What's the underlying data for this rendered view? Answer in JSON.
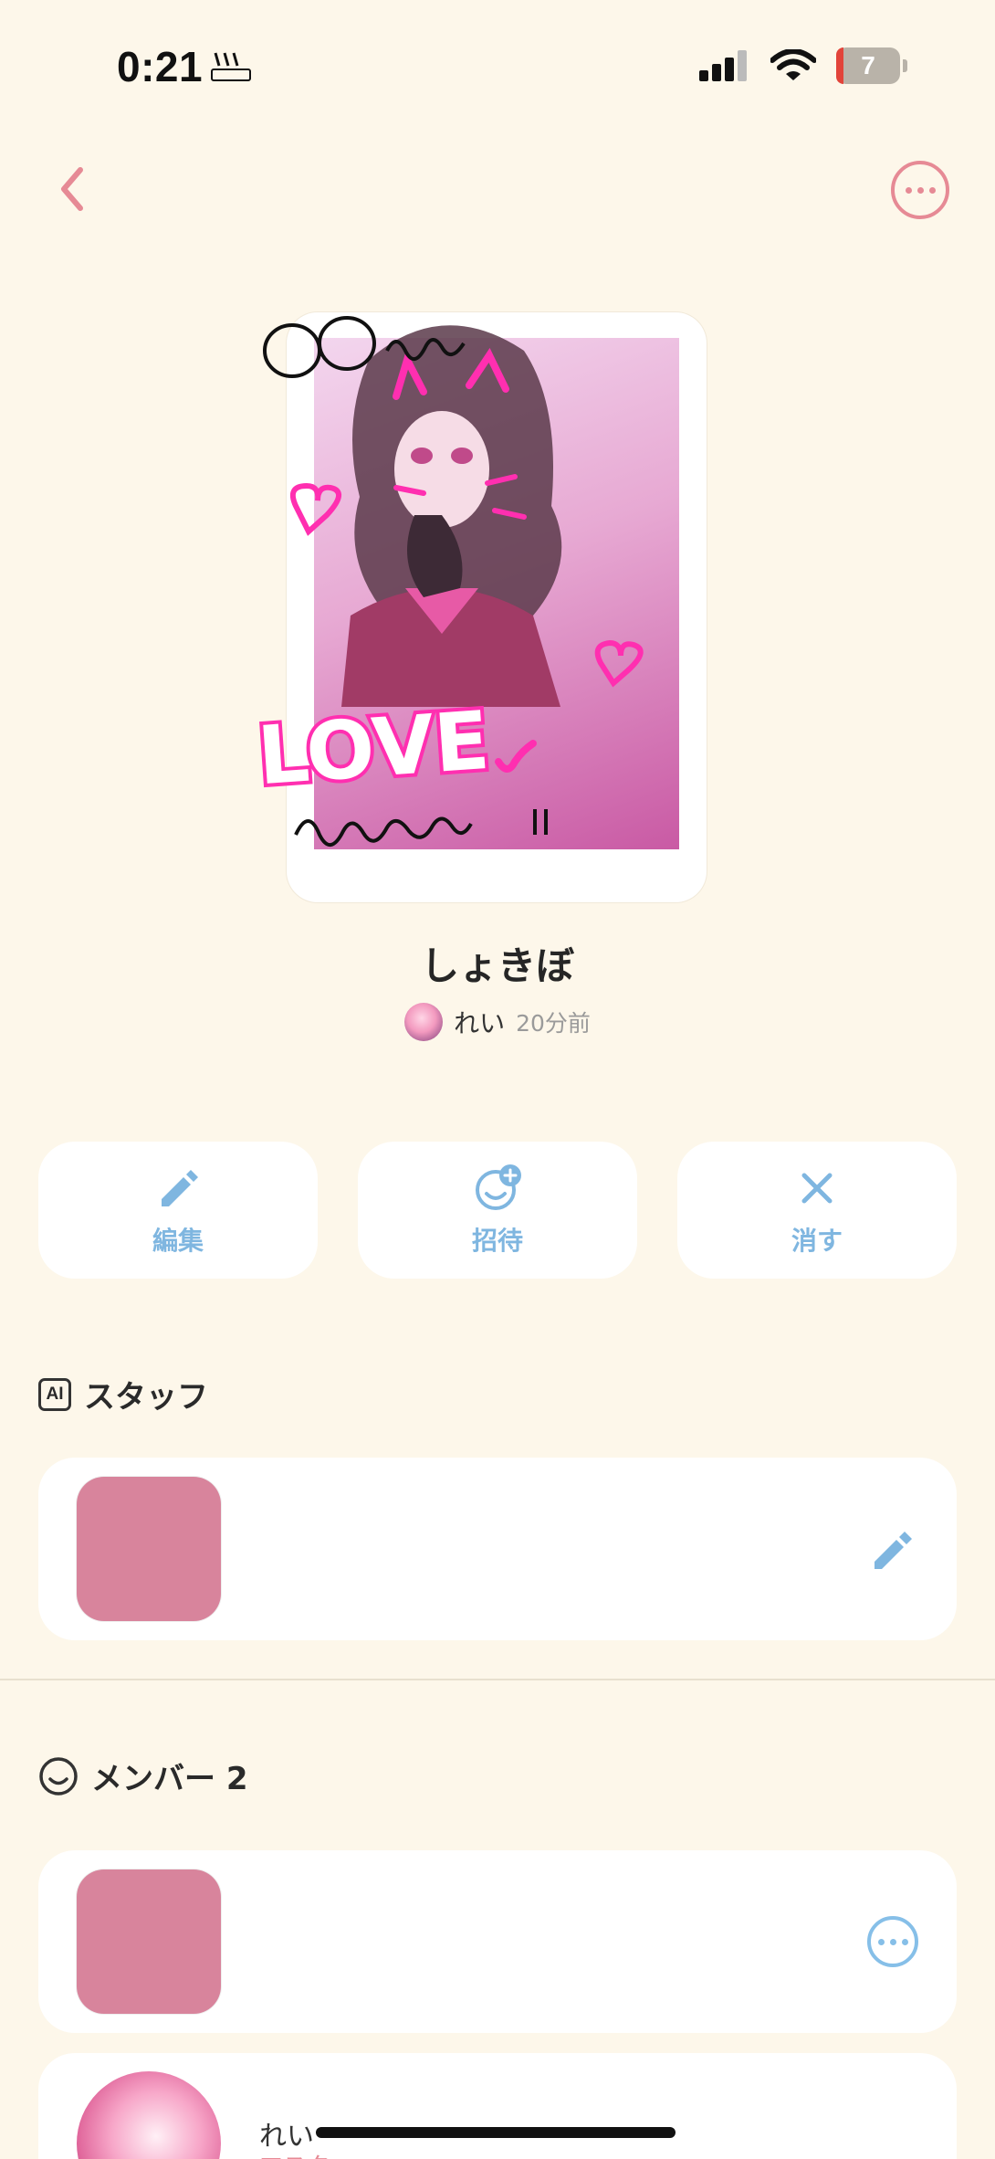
{
  "status": {
    "time": "0:21",
    "battery": "7"
  },
  "nav": {
    "back_icon": "chevron-left-icon",
    "more_icon": "more-horizontal-icon"
  },
  "card": {
    "title": "しょきぼ",
    "author": "れい",
    "time_ago": "20分前"
  },
  "actions": [
    {
      "label": "編集",
      "icon": "pencil-icon"
    },
    {
      "label": "招待",
      "icon": "invite-icon"
    },
    {
      "label": "消す",
      "icon": "close-icon"
    }
  ],
  "staff": {
    "icon_label": "AI",
    "heading": "スタッフ"
  },
  "members": {
    "heading": "メンバー 2",
    "list": [
      {
        "name": "れい",
        "role": "マスター"
      }
    ]
  },
  "colors": {
    "background": "#fdf7ea",
    "accent_pink": "#e68a95",
    "accent_blue": "#7fb6e0",
    "thumb_pink": "#d8849c"
  }
}
